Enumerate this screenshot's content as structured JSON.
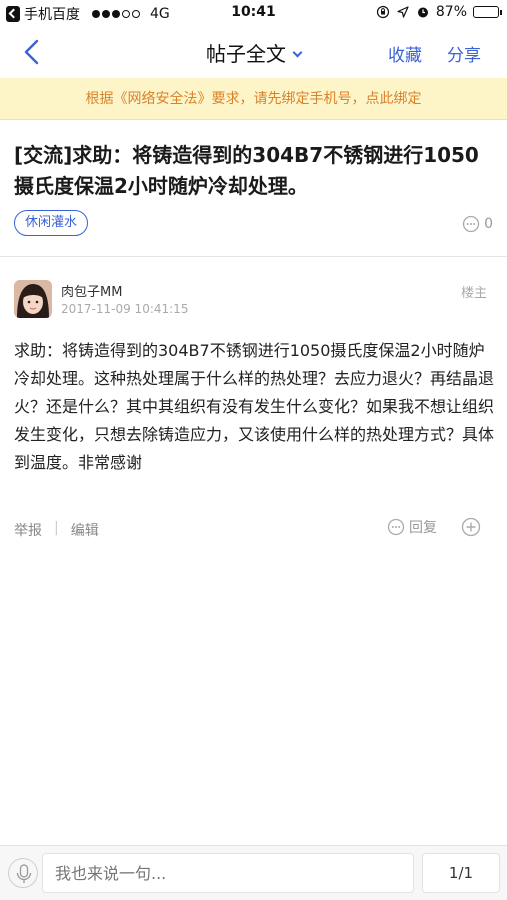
{
  "status_bar": {
    "app": "手机百度",
    "network": "4G",
    "time": "10:41",
    "battery": "87%",
    "battery_level": 0.87
  },
  "nav": {
    "title": "帖子全文",
    "favorite": "收藏",
    "share": "分享"
  },
  "notice": "根据《网络安全法》要求，请先绑定手机号，点此绑定",
  "post": {
    "title": "[交流]求助：将铸造得到的304B7不锈钢进行1050摄氏度保温2小时随炉冷却处理。",
    "tag": "休闲灌水",
    "comment_count": "0"
  },
  "first_floor": {
    "author": "肉包子MM",
    "date": "2017-11-09 10:41:15",
    "floor": "楼主",
    "content": "求助：将铸造得到的304B7不锈钢进行1050摄氏度保温2小时随炉冷却处理。这种热处理属于什么样的热处理？去应力退火？再结晶退火？还是什么？其中其组织有没有发生什么变化？如果我不想让组织发生变化，只想去除铸造应力，又该使用什么样的热处理方式？具体到温度。非常感谢",
    "report": "举报",
    "separator": "|",
    "edit": "编辑",
    "reply": "回复"
  },
  "composer": {
    "placeholder": "我也来说一句...",
    "pager": "1/1"
  }
}
